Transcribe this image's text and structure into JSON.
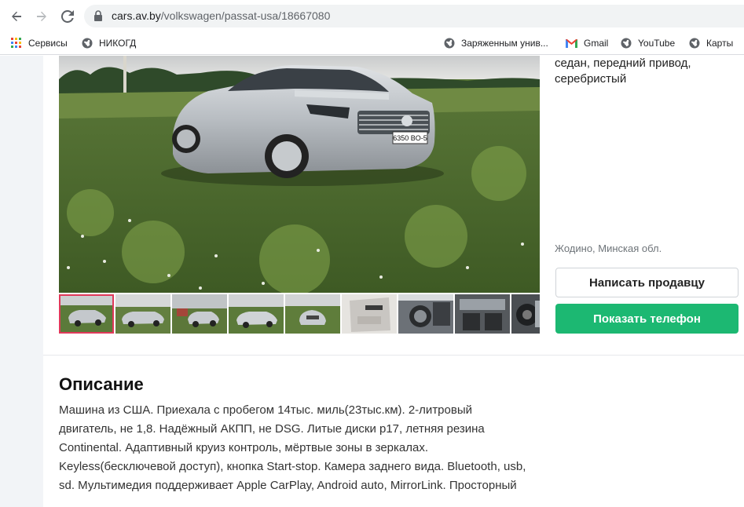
{
  "browser": {
    "url_host": "cars.av.by",
    "url_path": "/volkswagen/passat-usa/18667080"
  },
  "bookmarks": [
    {
      "label": "Сервисы",
      "icon": "apps-grid-icon"
    },
    {
      "label": "НИКОГД",
      "icon": "globe-icon"
    },
    {
      "label": "Заряженным унив...",
      "icon": "globe-icon"
    },
    {
      "label": "Gmail",
      "icon": "gmail-icon"
    },
    {
      "label": "YouTube",
      "icon": "globe-icon"
    },
    {
      "label": "Карты",
      "icon": "globe-icon"
    }
  ],
  "listing": {
    "summary_line1": "седан, передний привод,",
    "summary_line2": "серебристый",
    "location": "Жодино, Минская обл.",
    "plate": "6350 BO-5",
    "write_seller_label": "Написать продавцу",
    "show_phone_label": "Показать телефон",
    "thumbnail_count": 9,
    "active_thumbnail": 1
  },
  "description": {
    "title": "Описание",
    "lines": [
      "Машина из США. Приехала с пробегом 14тыс. миль(23тыс.км). 2-литровый",
      "двигатель, не 1,8. Надёжный АКПП, не DSG. Литые диски р17, летняя резина",
      "Continental. Адаптивный круиз контроль, мёртвые зоны в зеркалах.",
      "Keyless(бесключевой доступ), кнопка Start-stop. Камера заднего вида. Bluetooth, usb,",
      "sd. Мультимедия поддерживает Apple CarPlay, Android auto, MirrorLink. Просторный"
    ]
  },
  "colors": {
    "accent_green": "#1cb872",
    "active_thumb_border": "#e0395a"
  }
}
